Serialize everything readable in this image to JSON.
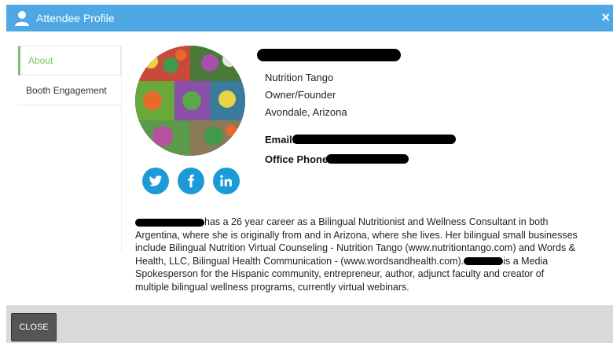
{
  "header": {
    "title": "Attendee Profile",
    "close_glyph": "×",
    "color": "#4ea8e3",
    "icon": "user-icon"
  },
  "sidebar": {
    "items": [
      {
        "label": "About",
        "active": true
      },
      {
        "label": "Booth Engagement",
        "active": false
      }
    ]
  },
  "profile": {
    "company": "Nutrition Tango",
    "role": "Owner/Founder",
    "location": "Avondale, Arizona",
    "email_label": "Email:",
    "phone_label": "Office Phone:"
  },
  "social": [
    {
      "icon": "twitter-icon"
    },
    {
      "icon": "facebook-icon"
    },
    {
      "icon": "linkedin-icon"
    }
  ],
  "bio": {
    "line1": "has a 26 year career as a Bilingual Nutritionist and Wellness Consultant in both",
    "line2": "Argentina, where she is originally from and in Arizona, where she lives. Her bilingual small businesses",
    "line3": "include Bilingual Nutrition Virtual Counseling - Nutrition Tango (www.nutritiontango.com) and Words &",
    "line4": "Health, LLC, Bilingual Health Communication - (www.wordsandhealth.com).",
    "line4b": "is a Media",
    "line5": "Spokesperson for the Hispanic community, entrepreneur, author, adjunct faculty and creator of",
    "line6": "multiple bilingual wellness programs, currently virtual webinars."
  },
  "footer": {
    "close_label": "CLOSE"
  }
}
